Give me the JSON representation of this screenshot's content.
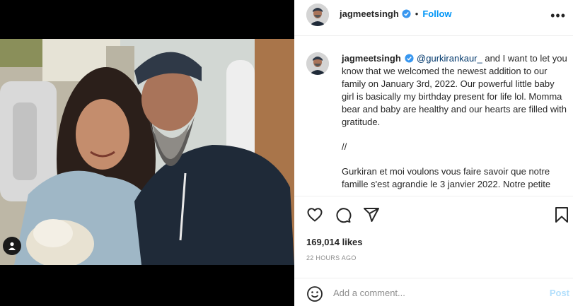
{
  "post": {
    "username": "jagmeetsingh",
    "follow_label": "Follow",
    "separator": "•",
    "more_label": "•••",
    "caption": {
      "mention": "@gurkirankaur_",
      "paragraph1": " and I want to let you know that we welcomed the newest addition to our family on January 3rd, 2022. Our powerful little baby girl is basically my birthday present for life lol. Momma bear and baby are healthy and our hearts are filled with gratitude.",
      "paragraph2": "//",
      "paragraph3": "Gurkiran et moi voulons vous faire savoir que notre famille s'est agrandie le 3 janvier 2022. Notre petite"
    },
    "likes": "169,014 likes",
    "timestamp": "22 HOURS AGO",
    "comment": {
      "placeholder": "Add a comment...",
      "post_label": "Post"
    }
  },
  "icons": {
    "verified": "verified-badge-icon",
    "like": "heart-icon",
    "comment": "comment-icon",
    "share": "paper-plane-icon",
    "save": "bookmark-icon",
    "emoji": "smiley-icon",
    "tagged": "user-tag-icon"
  },
  "colors": {
    "accent": "#0095f6",
    "verified": "#3897f0",
    "post_disabled": "#b2dffc",
    "muted": "#8e8e8e"
  }
}
